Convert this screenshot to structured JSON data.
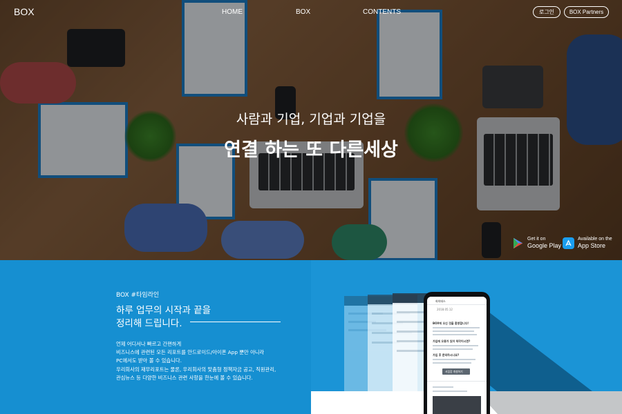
{
  "nav": {
    "logo": "BOX",
    "items": [
      "HOME",
      "BOX",
      "CONTENTS"
    ],
    "login_label": "로그인",
    "partners_label": "BOX Partners"
  },
  "hero": {
    "subtitle": "사람과 기업, 기업과 기업을",
    "title": "연결 하는 또 다른세상",
    "google_play": {
      "top": "Get it on",
      "bottom": "Google Play"
    },
    "app_store": {
      "top": "Available on the",
      "bottom": "App Store"
    }
  },
  "timeline": {
    "tag": "BOX #타임라인",
    "heading_line1": "하루 업무의 시작과 끝을",
    "heading_line2": "정리해 드립니다.",
    "description": [
      "언제 어디서나 빠르고 간편하게",
      "비즈니스에 관련된 모든 리포트를 안드로이드/아이폰 App 뿐만 아니라",
      "PC에서도 받아 볼 수 있습니다.",
      "우리회사의 재무리포트는 물론, 우리회사의 맞춤형 정책자금 공고, 직원관리,",
      "관심뉴스 등 다양한 비즈니스 관련 사항을 한눈에 볼 수 있습니다."
    ]
  },
  "phone": {
    "app_title": "회의테스",
    "date": "2018.05.12",
    "card_title": "BOX에 오신 것을 환영합니다!",
    "card_heading2": "가입에 오류가 있어 착각이시면?",
    "card_heading3": "가입 후 문의하시나요?",
    "button_label": "서립장 개설하기"
  },
  "colors": {
    "lower_bg": "#168fd1",
    "dark_triangle": "#0f5f8e",
    "gray_triangle": "#c4c6c8",
    "accent": "#1c7fc8"
  }
}
